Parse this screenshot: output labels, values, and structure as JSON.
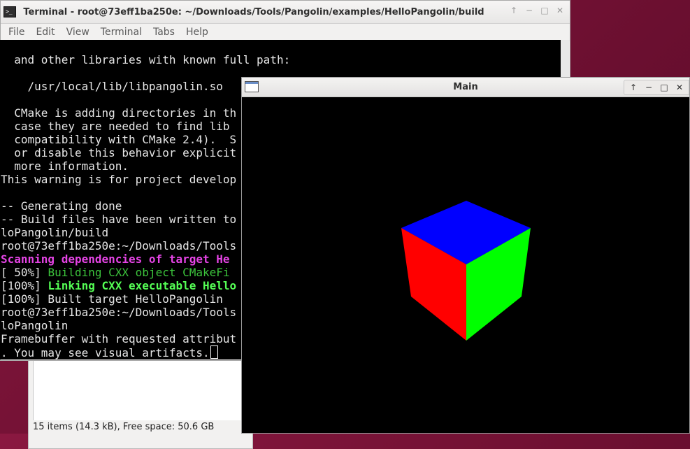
{
  "file_manager": {
    "status": "15 items (14.3 kB), Free space: 50.6 GB"
  },
  "terminal": {
    "title": "Terminal - root@73eff1ba250e: ~/Downloads/Tools/Pangolin/examples/HelloPangolin/build",
    "menu": [
      "File",
      "Edit",
      "View",
      "Terminal",
      "Tabs",
      "Help"
    ],
    "lines": {
      "l1": "  and other libraries with known full path:",
      "l2": "    /usr/local/lib/libpangolin.so",
      "l3": "  CMake is adding directories in th",
      "l4": "  case they are needed to find lib",
      "l5": "  compatibility with CMake 2.4).  S",
      "l6": "  or disable this behavior explicit",
      "l7": "  more information.",
      "l8": "This warning is for project develop",
      "l9": "-- Generating done",
      "l10": "-- Build files have been written to",
      "l11": "loPangolin/build",
      "l12": "root@73eff1ba250e:~/Downloads/Tools",
      "l13": "Scanning dependencies of target He",
      "l14_prefix": "[ 50%] ",
      "l14": "Building CXX object CMakeFi",
      "l15_prefix": "[100%] ",
      "l15": "Linking CXX executable Hello",
      "l16": "[100%] Built target HelloPangolin",
      "l17": "root@73eff1ba250e:~/Downloads/Tools",
      "l18": "loPangolin",
      "l19": "Framebuffer with requested attribut",
      "l20": ". You may see visual artifacts."
    }
  },
  "main_window": {
    "title": "Main",
    "cube_colors": {
      "top": "#0000ff",
      "left": "#ff0000",
      "right": "#00ff00"
    }
  },
  "icons": {
    "terminal_icon": ">_",
    "up": "↑",
    "minimize": "−",
    "maximize": "□",
    "close": "✕"
  }
}
